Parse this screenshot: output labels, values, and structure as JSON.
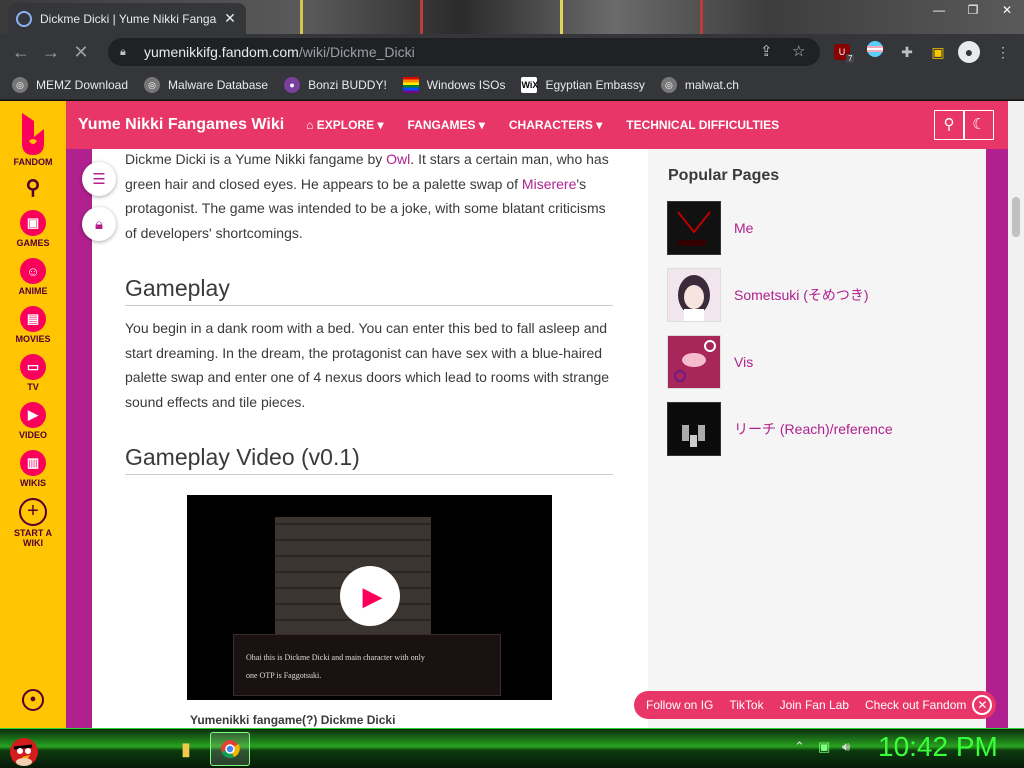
{
  "browser": {
    "tab_title": "Dickme Dicki | Yume Nikki Fanga",
    "url_domain": "yumenikkifg.fandom.com",
    "url_path": "/wiki/Dickme_Dicki",
    "ublock_count": "7"
  },
  "bookmarks": [
    {
      "label": "MEMZ Download",
      "icon": "globe-icon"
    },
    {
      "label": "Malware Database",
      "icon": "globe-icon"
    },
    {
      "label": "Bonzi BUDDY!",
      "icon": "bonzi-icon"
    },
    {
      "label": "Windows ISOs",
      "icon": "rainbow-flag-icon"
    },
    {
      "label": "Egyptian Embassy",
      "icon": "wix-icon",
      "badge": "WiX"
    },
    {
      "label": "malwat.ch",
      "icon": "globe-icon"
    }
  ],
  "global_nav": {
    "fandom": "FANDOM",
    "games": "GAMES",
    "anime": "ANIME",
    "movies": "MOVIES",
    "tv": "TV",
    "video": "VIDEO",
    "wikis": "WIKIS",
    "start_a_wiki": "START A WIKI"
  },
  "wiki_header": {
    "title": "Yume Nikki Fangames Wiki",
    "nav": [
      "EXPLORE",
      "FANGAMES",
      "CHARACTERS",
      "TECHNICAL DIFFICULTIES"
    ]
  },
  "article": {
    "intro": {
      "p1": "Dickme Dicki is a Yume Nikki fangame by ",
      "link_owl": "Owl",
      "p2": ". It stars a certain man, who has green hair and closed eyes. He appears to be a palette swap of ",
      "link_miserere": "Miserere",
      "p3": "'s protagonist. The game was intended to be a joke, with some blatant criticisms of developers' shortcomings."
    },
    "gameplay_heading": "Gameplay",
    "gameplay_text": "You begin in a dank room with a bed. You can enter this bed to fall asleep and start dreaming. In the dream, the protagonist can have sex with a blue-haired palette swap and enter one of 4 nexus doors which lead to rooms with strange sound effects and tile pieces.",
    "video_heading": "Gameplay Video (v0.1)",
    "video_dialog_line1": "Ohai this is Dickme Dicki and main character with only",
    "video_dialog_line2": "one OTP is Faggotsuki.",
    "video_caption": "Yumenikki fangame(?) Dickme Dicki"
  },
  "popular_pages": {
    "title": "Popular Pages",
    "items": [
      {
        "label": "Me"
      },
      {
        "label": "Sometsuki (そめつき)"
      },
      {
        "label": "Vis"
      },
      {
        "label": "リーチ (Reach)/reference"
      }
    ]
  },
  "social_bar": {
    "items": [
      "Follow on IG",
      "TikTok",
      "Join Fan Lab",
      "Check out Fandom"
    ]
  },
  "taskbar": {
    "clock": "10:42 PM"
  },
  "colors": {
    "fandom_yellow": "#ffc500",
    "wiki_header": "#e93668",
    "wiki_bg": "#b0218f",
    "link": "#b0218f",
    "clock_green": "#39ff39"
  }
}
